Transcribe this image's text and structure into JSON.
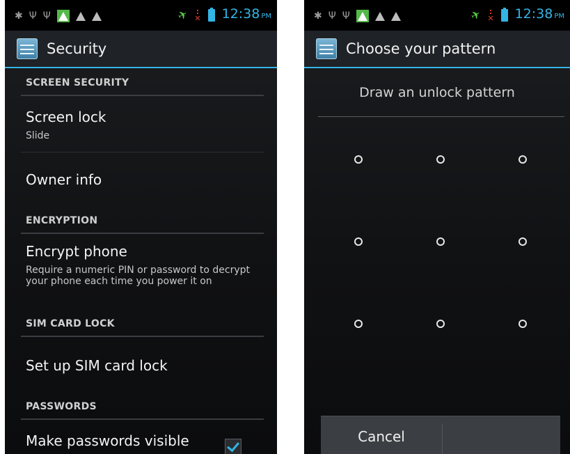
{
  "status_bar": {
    "time": "12:38",
    "ampm": "PM",
    "icons": [
      "android-debug-icon",
      "usb-icon",
      "usb-icon",
      "warning-green-icon",
      "alert-icon",
      "alert-icon",
      "airplane-icon",
      "no-signal-icon",
      "battery-icon"
    ]
  },
  "left": {
    "title": "Security",
    "sections": {
      "screen_security": "SCREEN SECURITY",
      "encryption": "ENCRYPTION",
      "sim_card_lock": "SIM CARD LOCK",
      "passwords": "PASSWORDS"
    },
    "items": {
      "screen_lock": {
        "title": "Screen lock",
        "summary": "Slide"
      },
      "owner_info": {
        "title": "Owner info"
      },
      "encrypt_phone": {
        "title": "Encrypt phone",
        "summary": "Require a numeric PIN or password to decrypt your phone each time you power it on"
      },
      "sim_lock": {
        "title": "Set up SIM card lock"
      },
      "passwords_visible": {
        "title": "Make passwords visible",
        "checked": true
      }
    }
  },
  "right": {
    "title": "Choose your pattern",
    "header": "Draw an unlock pattern",
    "grid_size": 3,
    "buttons": {
      "cancel": "Cancel",
      "continue": ""
    }
  },
  "colors": {
    "accent": "#33b5e5",
    "warning_green": "#54b948",
    "airplane_green": "#5bd04a",
    "signal_red": "#e03b2a"
  }
}
